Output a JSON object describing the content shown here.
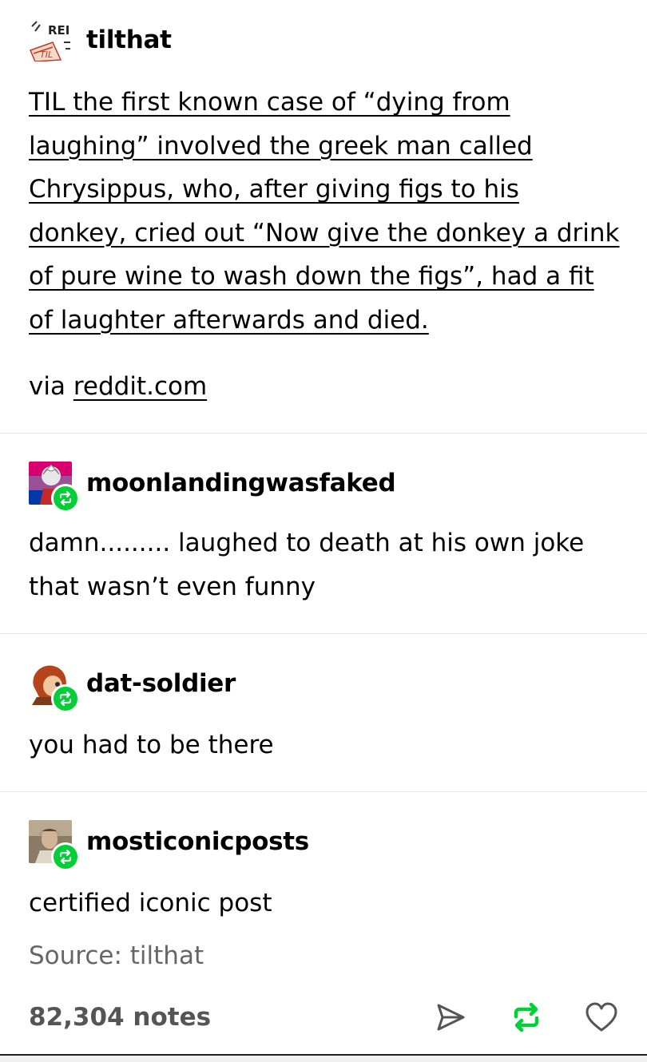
{
  "posts": [
    {
      "username": "tilthat",
      "avatar_icon": "til-logo-icon",
      "body": "TIL the first known case of “dying from laughing” involved the greek man called Chrysippus, who, after giving figs to his donkey, cried out “Now give the donkey a drink of pure wine to wash down the figs”, had a fit of laughter afterwards and died.",
      "via_prefix": "via",
      "via_link": "reddit.com"
    }
  ],
  "reblogs": [
    {
      "username": "moonlandingwasfaked",
      "text": "damn......... laughed to death at his own joke that wasn’t even funny"
    },
    {
      "username": "dat-soldier",
      "text": "you had to be there"
    },
    {
      "username": "mosticonicposts",
      "text": "certified iconic post"
    }
  ],
  "footer": {
    "source": "Source: tilthat",
    "notes": "82,304 notes",
    "actions": [
      "share-icon",
      "reblog-icon",
      "like-icon"
    ]
  },
  "colors": {
    "reblog_green": "#00cf35",
    "muted_text": "#666666",
    "notes_text": "#555555",
    "divider": "#e6e6e6"
  }
}
